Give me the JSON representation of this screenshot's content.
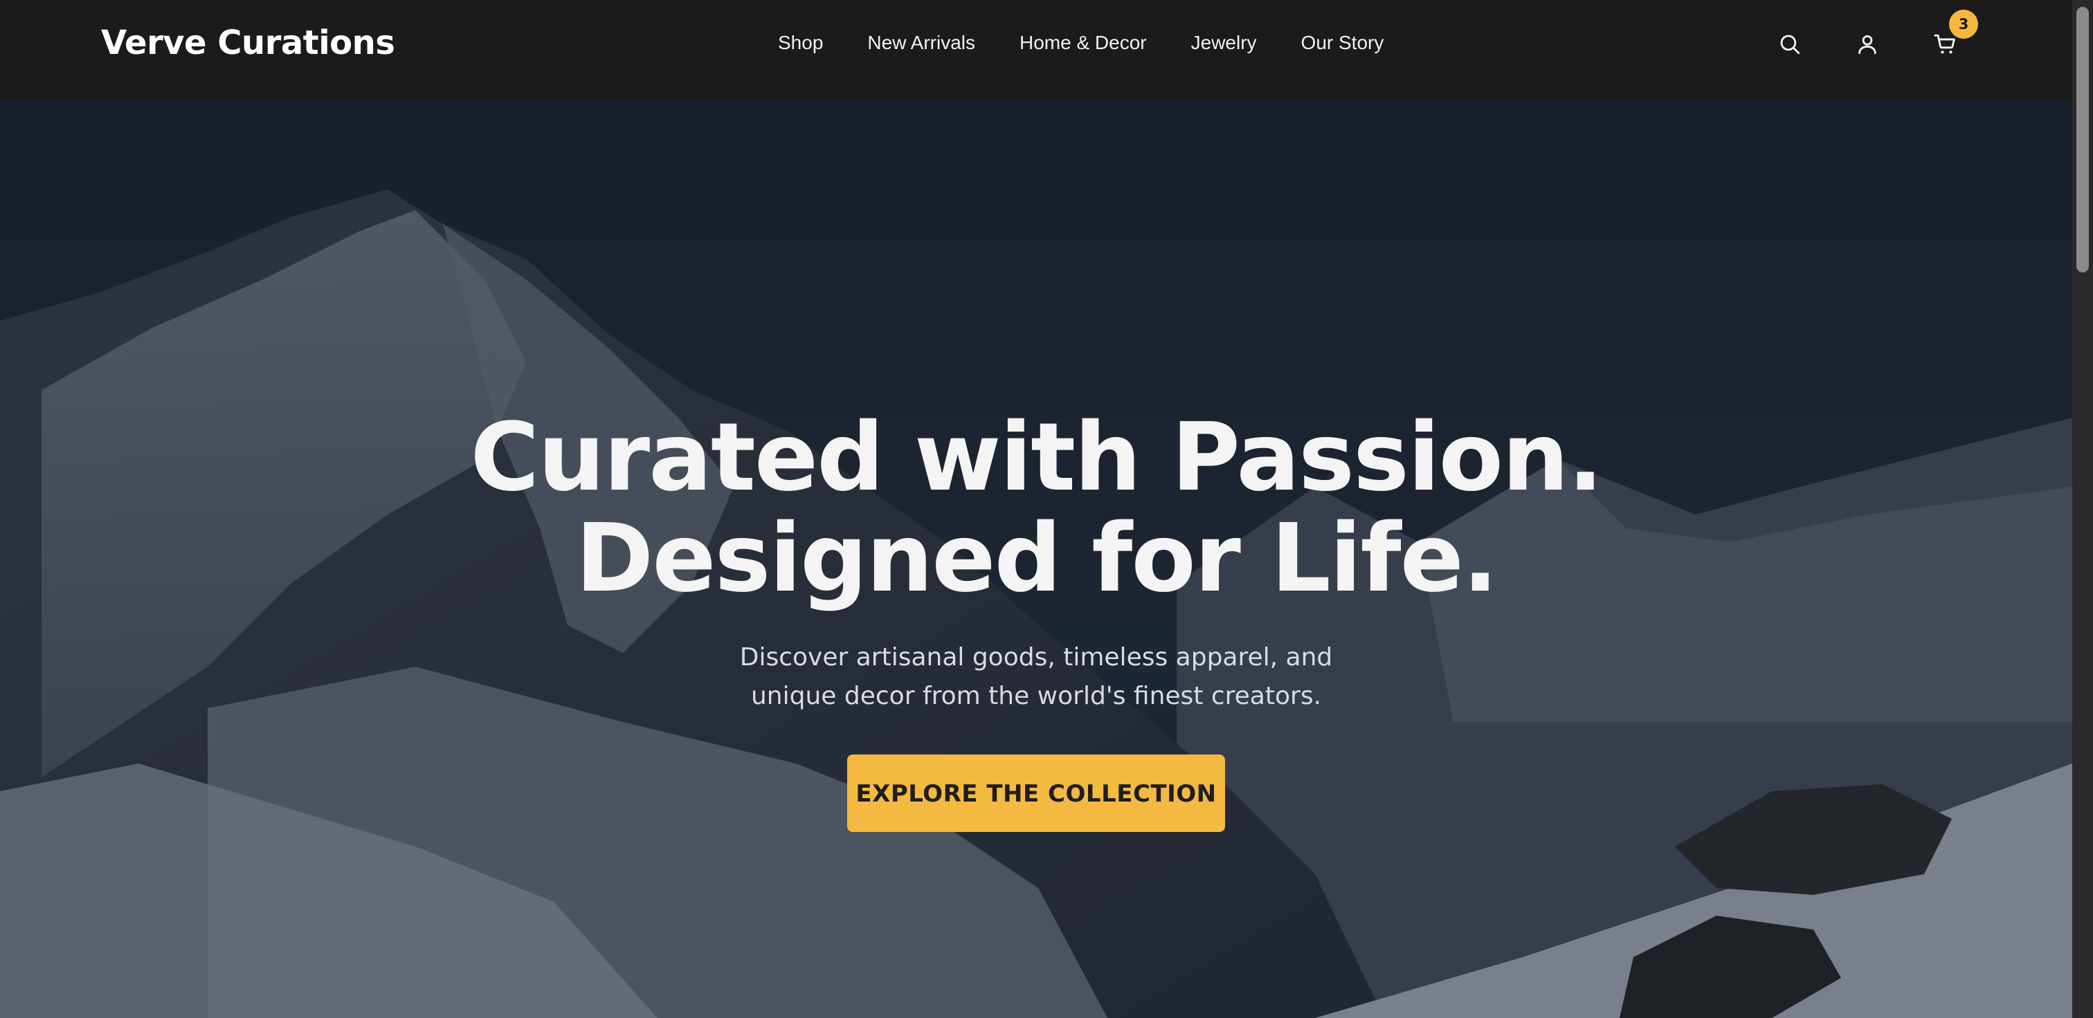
{
  "brand": {
    "name": "Verve Curations"
  },
  "nav": {
    "items": [
      {
        "label": "Shop"
      },
      {
        "label": "New Arrivals"
      },
      {
        "label": "Home & Decor"
      },
      {
        "label": "Jewelry"
      },
      {
        "label": "Our Story"
      }
    ]
  },
  "header_actions": {
    "search_icon": "search-icon",
    "account_icon": "user-icon",
    "cart_icon": "cart-icon",
    "cart_count": "3"
  },
  "hero": {
    "title_line1": "Curated with Passion.",
    "title_line2": "Designed for Life.",
    "subtitle_line1": "Discover artisanal goods, timeless apparel, and",
    "subtitle_line2": "unique decor from the world's finest creators.",
    "cta_label": "EXPLORE THE COLLECTION",
    "background_image": "snowy-mountain-photo"
  },
  "colors": {
    "header_bg": "#1b1b1b",
    "accent": "#f4b941",
    "text_light": "#f4f4f4"
  }
}
